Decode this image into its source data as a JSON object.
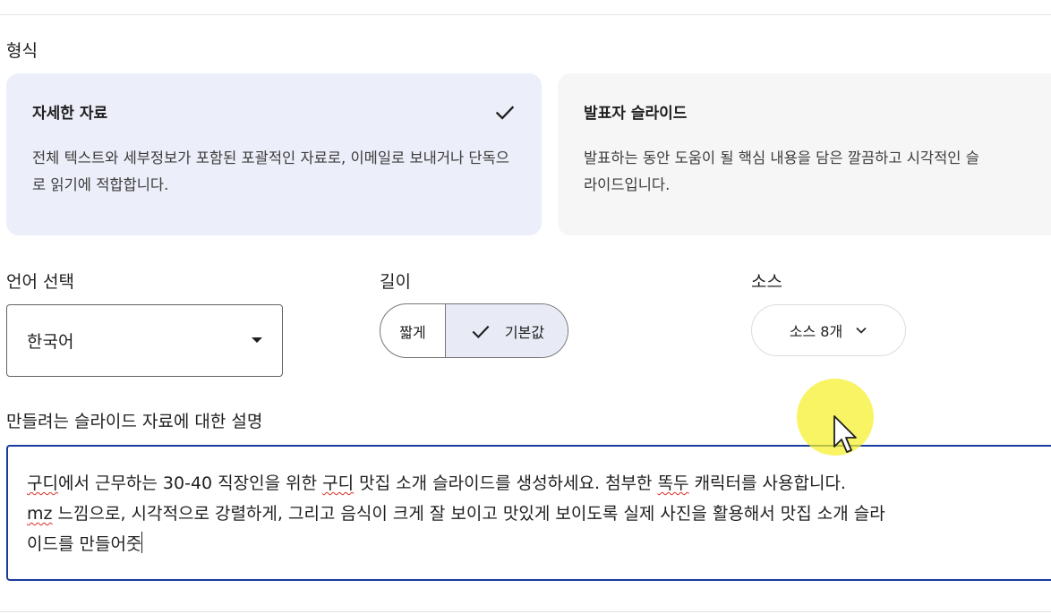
{
  "format": {
    "label": "형식",
    "options": [
      {
        "title": "자세한 자료",
        "description": "전체 텍스트와 세부정보가 포함된 포괄적인 자료로, 이메일로 보내거나 단독으로 읽기에 적합합니다.",
        "selected": true
      },
      {
        "title": "발표자 슬라이드",
        "description_line1": "발표하는 동안 도움이 될 핵심 내용을 담은 깔끔하고 시각적인 슬",
        "description_line2": "라이드입니다.",
        "selected": false
      }
    ]
  },
  "language": {
    "label": "언어 선택",
    "value": "한국어"
  },
  "length": {
    "label": "길이",
    "options": [
      "짧게",
      "기본값"
    ],
    "selected": "기본값"
  },
  "source": {
    "label": "소스",
    "button": "소스 8개"
  },
  "description": {
    "label": "만들려는 슬라이드 자료에 대한 설명",
    "line1_a": "구디",
    "line1_b": "에서 근무하는 30-40 직장인을 위한 ",
    "line1_c": "구디",
    "line1_d": " 맛집 소개 슬라이드를 생성하세요. 첨부한 ",
    "line1_e": "똑두",
    "line1_f": " 캐릭터를 사용합니다.",
    "line2_a": "mz",
    "line2_b": " 느낌으로, 시각적으로 강렬하게, 그리고 음식이 크게 잘 보이고 맛있게 보이도록 실제 사진을 활용해서 맛집 소개 슬라",
    "line3_a": "이드를 만들어",
    "line3_b": "줏"
  },
  "colors": {
    "selected_card": "#eceef9",
    "focus_border": "#1a3a9e",
    "cursor_highlight": "#f5f028"
  }
}
